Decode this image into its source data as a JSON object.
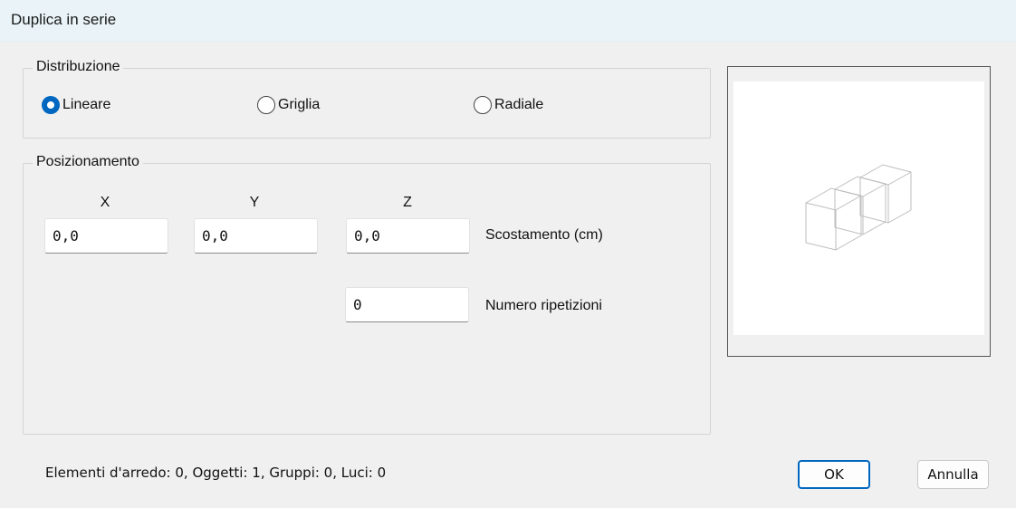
{
  "window": {
    "title": "Duplica in serie"
  },
  "distribution": {
    "label": "Distribuzione",
    "options": [
      {
        "label": "Lineare",
        "checked": true
      },
      {
        "label": "Griglia",
        "checked": false
      },
      {
        "label": "Radiale",
        "checked": false
      }
    ]
  },
  "positioning": {
    "label": "Posizionamento",
    "axes": [
      "X",
      "Y",
      "Z"
    ],
    "offset": {
      "x": "0,0",
      "y": "0,0",
      "z": "0,0",
      "label": "Scostamento (cm)"
    },
    "repetitions": {
      "value": "0",
      "label": "Numero ripetizioni"
    }
  },
  "preview": {
    "icon": "three-cubes-preview-icon"
  },
  "status": {
    "text": "Elementi d'arredo: 0, Oggetti: 1, Gruppi: 0, Luci: 0"
  },
  "buttons": {
    "ok": "OK",
    "cancel": "Annulla"
  },
  "colors": {
    "accent": "#0067c0",
    "titlebar": "#eaf4f8",
    "background": "#f0f0f0"
  }
}
